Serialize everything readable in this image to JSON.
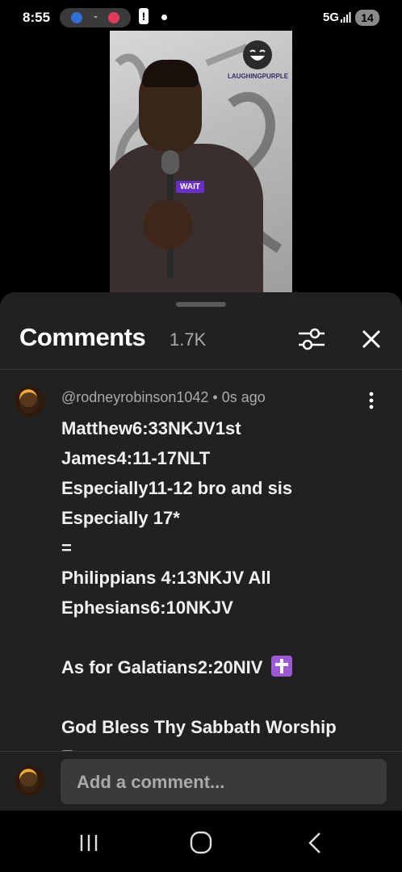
{
  "status_bar": {
    "time": "8:55",
    "pill_separator": "-",
    "alert": "!",
    "network": "5G",
    "battery": "14"
  },
  "video": {
    "caption_tag": "WAIT",
    "channel_watermark": "LAUGHINGPURPLE"
  },
  "comments": {
    "title": "Comments",
    "count": "1.7K",
    "items": [
      {
        "handle": "@rodneyrobinson1042",
        "separator": " • ",
        "time": "0s ago",
        "lines": [
          "Matthew6:33NKJV1st",
          "James4:11-17NLT",
          "Especially11-12 bro and sis",
          "Especially 17*",
          "=",
          "Philippians 4:13NKJV All",
          "Ephesians6:10NKJV",
          "",
          "As for Galatians2:20NIV",
          "",
          "God Bless Thy Sabbath Worship",
          "Everyone"
        ]
      }
    ],
    "add_placeholder": "Add a comment..."
  },
  "colors": {
    "sheet_bg": "#212121",
    "accent_purple": "#6b2fc9",
    "cross_emoji": "#9b59d6"
  },
  "icons": {
    "filter": "filter-sliders-icon",
    "close": "close-icon",
    "more": "more-vertical-icon",
    "nav_recents": "recent-apps-icon",
    "nav_home": "home-icon",
    "nav_back": "back-icon"
  }
}
